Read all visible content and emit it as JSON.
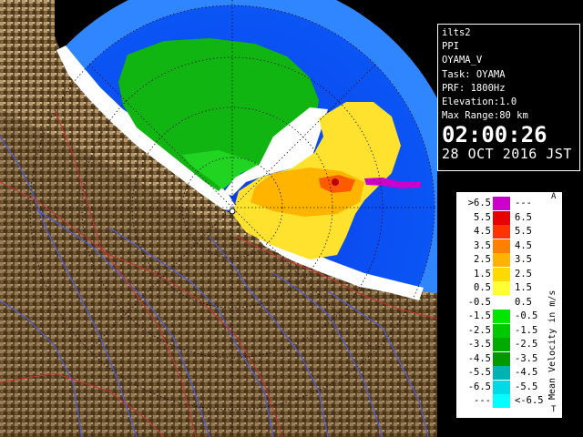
{
  "info": {
    "radar_id": "ilts2",
    "product": "PPI",
    "source": "OYAMA_V",
    "task": "Task: OYAMA",
    "prf": "PRF: 1800Hz",
    "elevation": "Elevation:1.0",
    "max_range": "Max Range:80 km",
    "time": "02:00:26",
    "date": "28 OCT 2016 JST"
  },
  "legend": {
    "title": "Mean Velocity in m/s",
    "corner_top": "A",
    "corner_bottom": "T",
    "rows": [
      {
        "lo": ">6.5",
        "hi": "---",
        "color": "#cc00cc"
      },
      {
        "lo": "5.5",
        "hi": "6.5",
        "color": "#e60000"
      },
      {
        "lo": "4.5",
        "hi": "5.5",
        "color": "#ff3300"
      },
      {
        "lo": "3.5",
        "hi": "4.5",
        "color": "#ff8000"
      },
      {
        "lo": "2.5",
        "hi": "3.5",
        "color": "#ffb300"
      },
      {
        "lo": "1.5",
        "hi": "2.5",
        "color": "#ffd900"
      },
      {
        "lo": "0.5",
        "hi": "1.5",
        "color": "#ffff33"
      },
      {
        "lo": "-0.5",
        "hi": "0.5",
        "color": "#ffffff"
      },
      {
        "lo": "-1.5",
        "hi": "-0.5",
        "color": "#00e600"
      },
      {
        "lo": "-2.5",
        "hi": "-1.5",
        "color": "#00c800"
      },
      {
        "lo": "-3.5",
        "hi": "-2.5",
        "color": "#00aa00"
      },
      {
        "lo": "-4.5",
        "hi": "-3.5",
        "color": "#009900"
      },
      {
        "lo": "-5.5",
        "hi": "-4.5",
        "color": "#00b3b3"
      },
      {
        "lo": "-6.5",
        "hi": "-5.5",
        "color": "#00d9e6"
      },
      {
        "lo": "---",
        "hi": "<-6.5",
        "color": "#00ffff"
      }
    ]
  },
  "map_colors": {
    "background": "#000000",
    "sea_clear": "#0a4cf0",
    "outer_ring": "#2f86ff",
    "land_dark": "#5b4424",
    "land_light": "#bfa27a",
    "river": "#4f5cd8",
    "boundary": "#c83232"
  }
}
